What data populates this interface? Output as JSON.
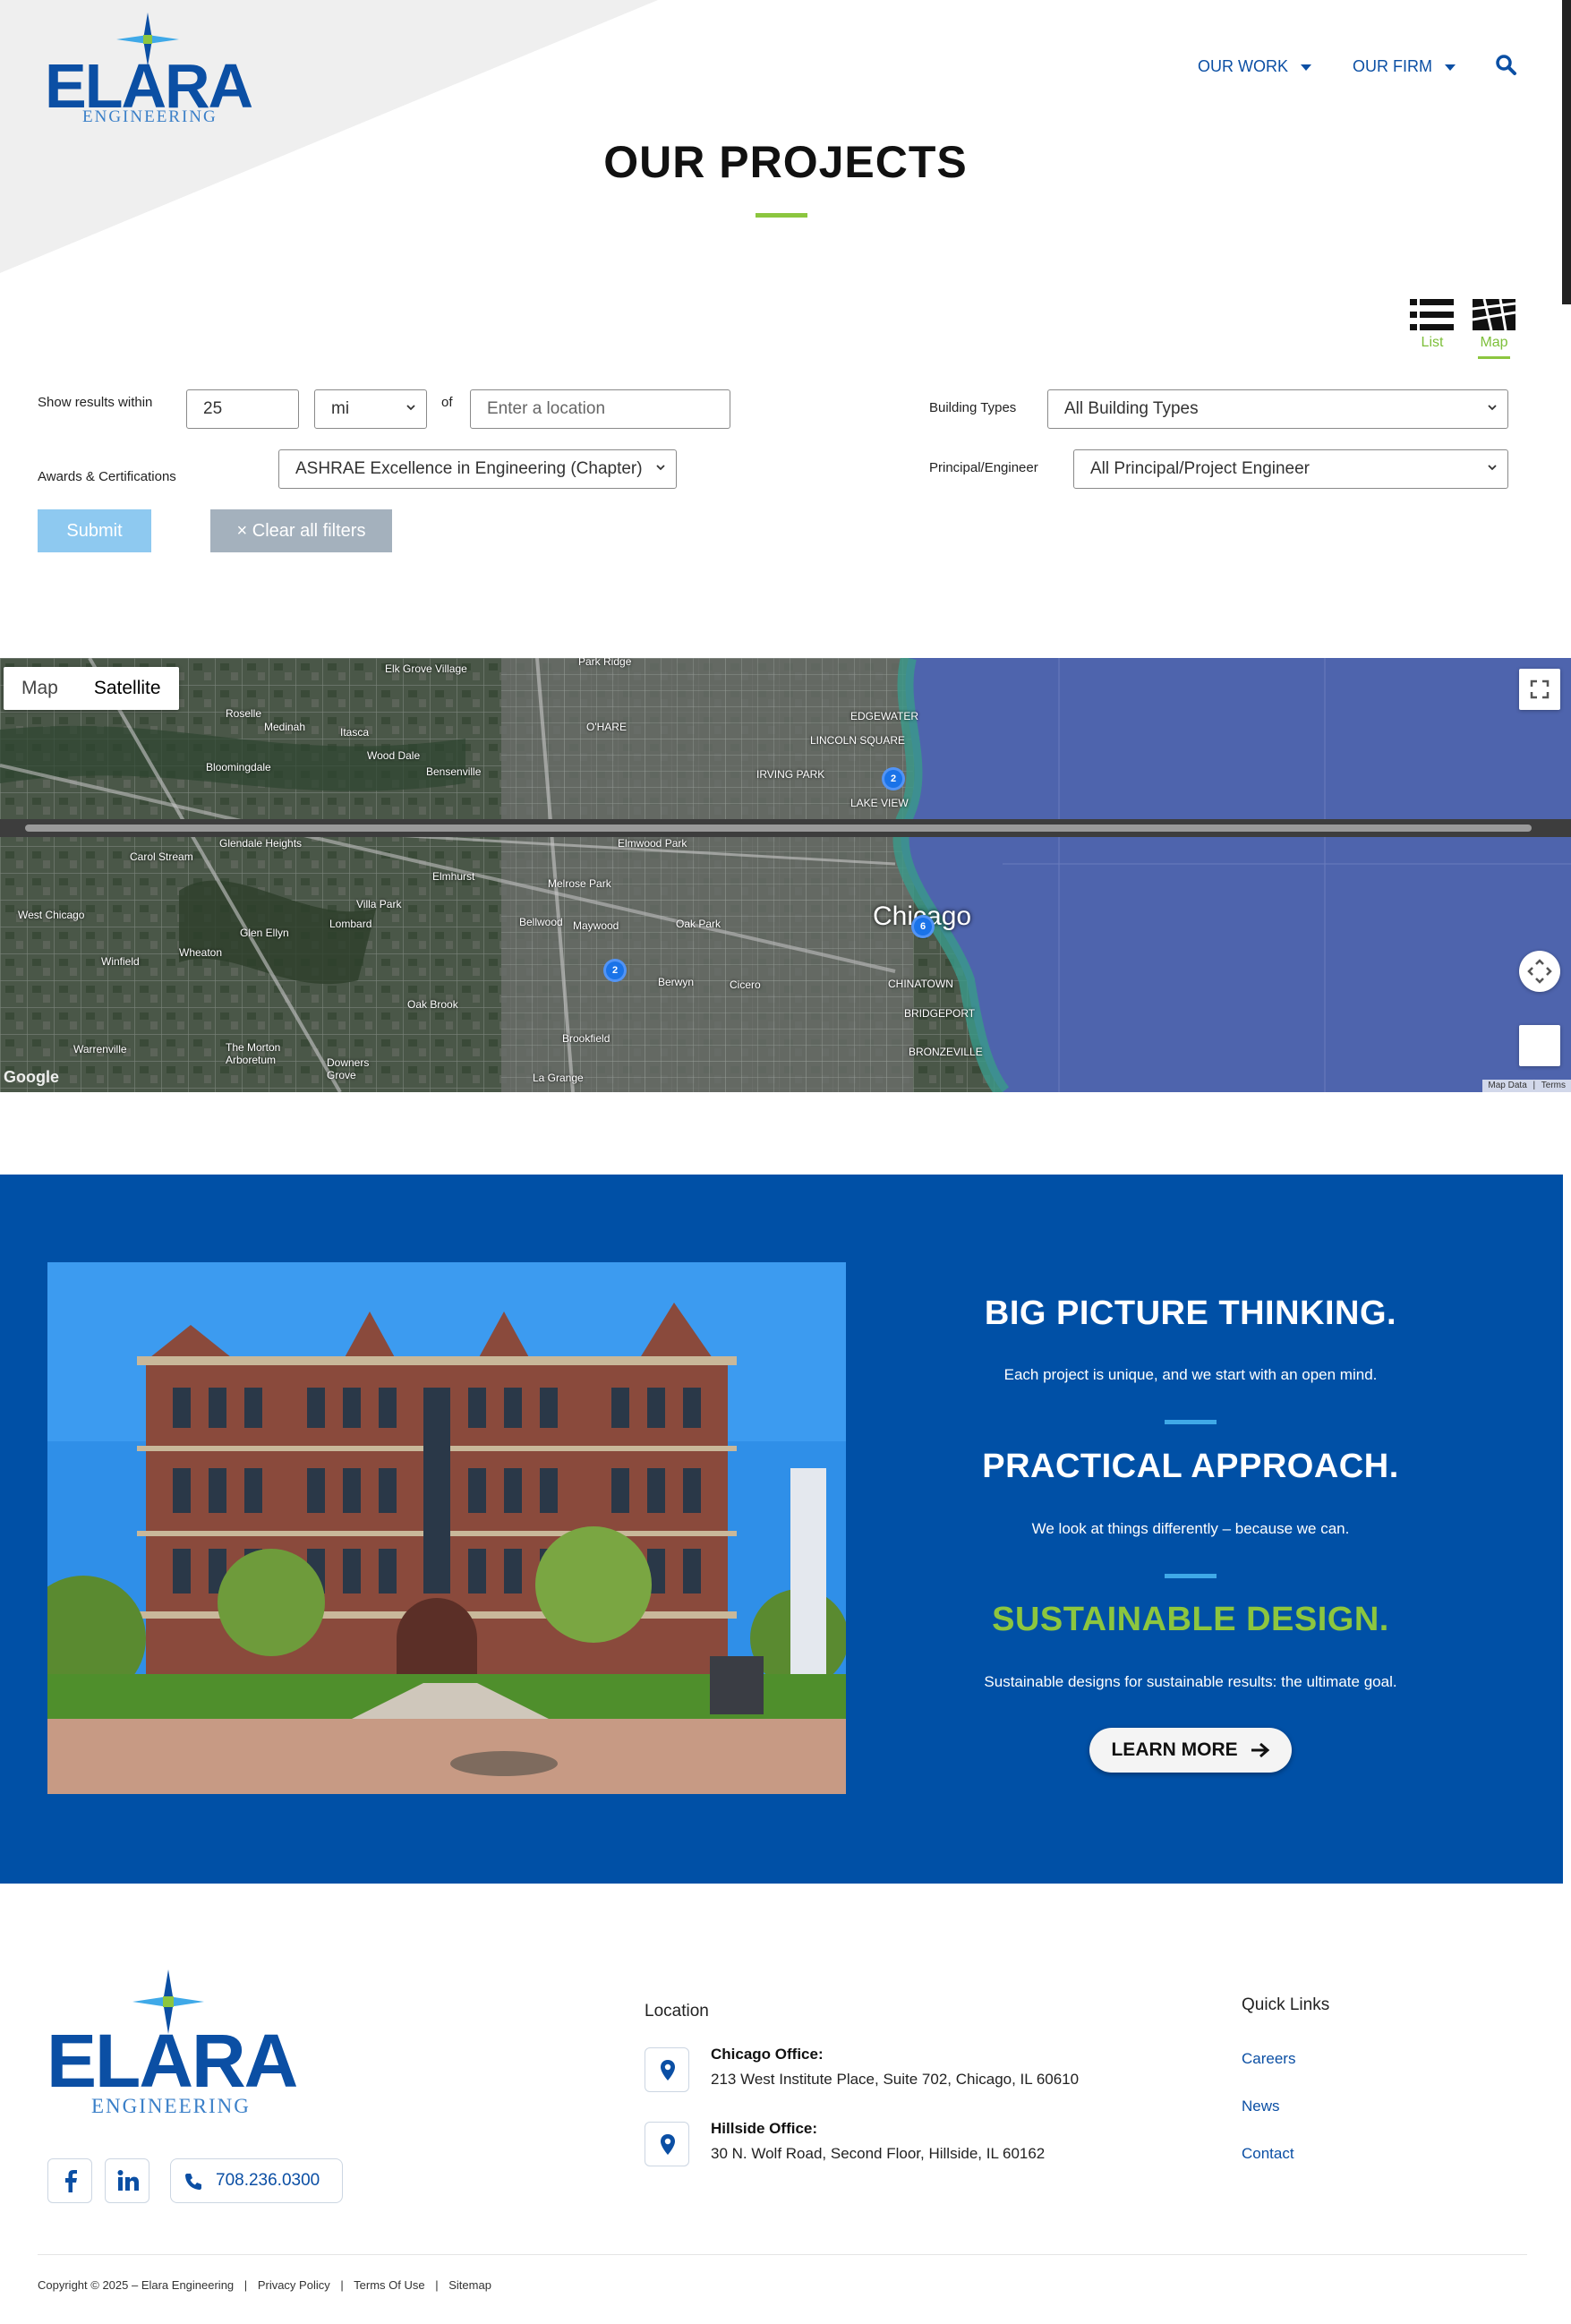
{
  "brand": {
    "name": "ELARA",
    "sub": "ENGINEERING",
    "colors": {
      "primary_blue": "#0b4fa4",
      "accent_green": "#8cc63f",
      "section_blue": "#0050a6",
      "light_blue": "#3fa9e8"
    }
  },
  "nav": {
    "items": [
      {
        "label": "OUR WORK"
      },
      {
        "label": "OUR FIRM"
      }
    ],
    "search_icon": "search-icon"
  },
  "page": {
    "title": "OUR PROJECTS"
  },
  "views": {
    "list_label": "List",
    "map_label": "Map",
    "active": "Map"
  },
  "filters": {
    "show_results_within_label": "Show results within",
    "distance_value": "25",
    "unit_value": "mi",
    "of_label": "of",
    "location_placeholder": "Enter a location",
    "building_types_label": "Building Types",
    "building_types_value": "All Building Types",
    "awards_label": "Awards & Certifications",
    "awards_value": "ASHRAE Excellence in Engineering (Chapter)",
    "principal_label": "Principal/Engineer",
    "principal_value": "All Principal/Project Engineer",
    "submit_label": "Submit",
    "clear_label": "× Clear all filters"
  },
  "map": {
    "type_options": [
      "Map",
      "Satellite"
    ],
    "active_type": "Satellite",
    "main_city": "Chicago",
    "places": [
      "Elk Grove Village",
      "Park Ridge",
      "Roselle",
      "Medinah",
      "Itasca",
      "Wood Dale",
      "Bensenville",
      "O'HARE",
      "EDGEWATER",
      "LINCOLN SQUARE",
      "IRVING PARK",
      "LAKE VIEW",
      "Bloomingdale",
      "Carol Stream",
      "Glendale Heights",
      "Elmwood Park",
      "Elmhurst",
      "Melrose Park",
      "Villa Park",
      "Lombard",
      "Bellwood",
      "Maywood",
      "Oak Park",
      "West Chicago",
      "Glen Ellyn",
      "Wheaton",
      "Winfield",
      "Oak Brook",
      "Berwyn",
      "Cicero",
      "CHINATOWN",
      "BRIDGEPORT",
      "BRONZEVILLE",
      "Brookfield",
      "Warrenville",
      "The Morton Arboretum",
      "Downers Grove",
      "La Grange",
      "Google"
    ],
    "clusters": [
      "2",
      "6",
      "2"
    ],
    "footer": [
      "Map Data",
      "Terms"
    ]
  },
  "promo": {
    "h1": "BIG PICTURE THINKING.",
    "p1": "Each project is unique, and we start with an open mind.",
    "h2": "PRACTICAL APPROACH.",
    "p2": "We look at things differently – because we can.",
    "h3": "SUSTAINABLE DESIGN.",
    "p3": "Sustainable designs for sustainable results: the ultimate goal.",
    "cta": "LEARN MORE"
  },
  "footer": {
    "location_heading": "Location",
    "offices": [
      {
        "title": "Chicago Office:",
        "address": "213 West Institute Place, Suite 702, Chicago, IL 60610"
      },
      {
        "title": "Hillside Office:",
        "address": "30 N. Wolf Road, Second Floor, Hillside, IL 60162"
      }
    ],
    "quick_links_heading": "Quick Links",
    "quick_links": [
      "Careers",
      "News",
      "Contact"
    ],
    "phone": "708.236.0300",
    "social": [
      "facebook-icon",
      "linkedin-icon"
    ],
    "copyright": "Copyright © 2025 – Elara Engineering",
    "legal_links": [
      "Privacy Policy",
      "Terms Of Use",
      "Sitemap"
    ],
    "separator": "|"
  }
}
